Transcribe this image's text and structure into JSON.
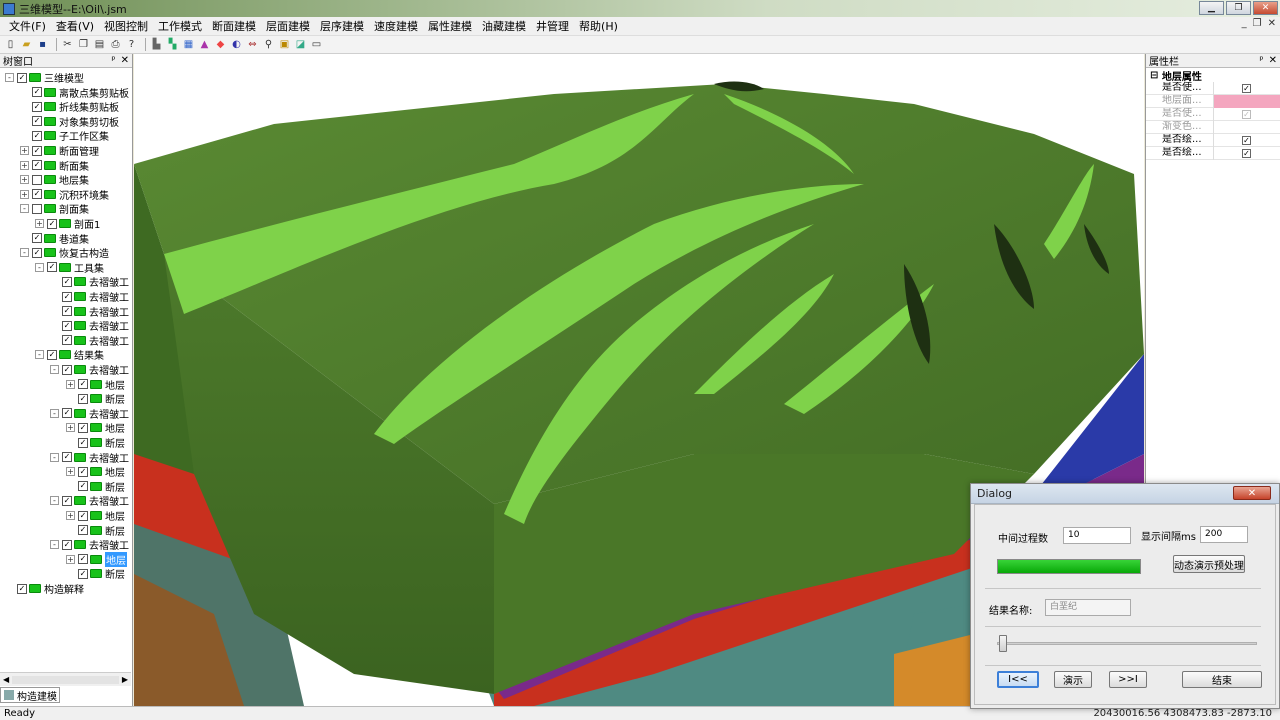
{
  "window": {
    "title": "三维模型--E:\\Oil\\.jsm"
  },
  "menu": [
    "文件(F)",
    "查看(V)",
    "视图控制",
    "工作模式",
    "断面建模",
    "层面建模",
    "层序建模",
    "速度建模",
    "属性建模",
    "油藏建模",
    "井管理",
    "帮助(H)"
  ],
  "toolbar_icons": [
    "new-icon",
    "open-icon",
    "save-icon",
    "cut-icon",
    "copy-icon",
    "paste-icon",
    "print-icon",
    "help-icon",
    "pan-icon",
    "fit-icon",
    "grid-icon",
    "layer-icon",
    "color-icon",
    "palette-icon",
    "arrows-icon",
    "zoom-icon",
    "rect-icon",
    "select-icon",
    "window-icon"
  ],
  "left_panel": {
    "title": "树窗口",
    "tab": "构造建模"
  },
  "tree": [
    {
      "label": "三维模型",
      "level": 0,
      "expand": "-",
      "checked": true
    },
    {
      "label": "离散点集剪贴板",
      "level": 1,
      "expand": "",
      "checked": true
    },
    {
      "label": "折线集剪贴板",
      "level": 1,
      "expand": "",
      "checked": true
    },
    {
      "label": "对象集剪切板",
      "level": 1,
      "expand": "",
      "checked": true
    },
    {
      "label": "子工作区集",
      "level": 1,
      "expand": "",
      "checked": true
    },
    {
      "label": "断面管理",
      "level": 1,
      "expand": "+",
      "checked": true
    },
    {
      "label": "断面集",
      "level": 1,
      "expand": "+",
      "checked": true
    },
    {
      "label": "地层集",
      "level": 1,
      "expand": "+",
      "checked": false
    },
    {
      "label": "沉积环境集",
      "level": 1,
      "expand": "+",
      "checked": true
    },
    {
      "label": "剖面集",
      "level": 1,
      "expand": "-",
      "checked": false
    },
    {
      "label": "剖面1",
      "level": 2,
      "expand": "+",
      "checked": true
    },
    {
      "label": "巷道集",
      "level": 1,
      "expand": "",
      "checked": true
    },
    {
      "label": "恢复古构造",
      "level": 1,
      "expand": "-",
      "checked": true
    },
    {
      "label": "工具集",
      "level": 2,
      "expand": "-",
      "checked": true
    },
    {
      "label": "去褶皱工",
      "level": 3,
      "expand": "",
      "checked": true
    },
    {
      "label": "去褶皱工",
      "level": 3,
      "expand": "",
      "checked": true
    },
    {
      "label": "去褶皱工",
      "level": 3,
      "expand": "",
      "checked": true
    },
    {
      "label": "去褶皱工",
      "level": 3,
      "expand": "",
      "checked": true
    },
    {
      "label": "去褶皱工",
      "level": 3,
      "expand": "",
      "checked": true
    },
    {
      "label": "结果集",
      "level": 2,
      "expand": "-",
      "checked": true
    },
    {
      "label": "去褶皱工",
      "level": 3,
      "expand": "-",
      "checked": true
    },
    {
      "label": "地层",
      "level": 4,
      "expand": "+",
      "checked": true
    },
    {
      "label": "断层",
      "level": 4,
      "expand": "",
      "checked": true
    },
    {
      "label": "去褶皱工",
      "level": 3,
      "expand": "-",
      "checked": true
    },
    {
      "label": "地层",
      "level": 4,
      "expand": "+",
      "checked": true
    },
    {
      "label": "断层",
      "level": 4,
      "expand": "",
      "checked": true
    },
    {
      "label": "去褶皱工",
      "level": 3,
      "expand": "-",
      "checked": true
    },
    {
      "label": "地层",
      "level": 4,
      "expand": "+",
      "checked": true
    },
    {
      "label": "断层",
      "level": 4,
      "expand": "",
      "checked": true
    },
    {
      "label": "去褶皱工",
      "level": 3,
      "expand": "-",
      "checked": true
    },
    {
      "label": "地层",
      "level": 4,
      "expand": "+",
      "checked": true
    },
    {
      "label": "断层",
      "level": 4,
      "expand": "",
      "checked": true
    },
    {
      "label": "去褶皱工",
      "level": 3,
      "expand": "-",
      "checked": true
    },
    {
      "label": "地层",
      "level": 4,
      "expand": "+",
      "checked": true,
      "selected": true
    },
    {
      "label": "断层",
      "level": 4,
      "expand": "",
      "checked": true
    },
    {
      "label": "构造解释",
      "level": 0,
      "expand": "",
      "checked": true
    }
  ],
  "right_panel": {
    "title": "属性栏",
    "group": "地层属性",
    "rows": [
      {
        "key": "是否使...",
        "value": "checked",
        "enabled": true
      },
      {
        "key": "地层面...",
        "value": "color",
        "color": "#f4a6bf",
        "enabled": false
      },
      {
        "key": "是否使...",
        "value": "checked",
        "enabled": false
      },
      {
        "key": "渐变色...",
        "value": "",
        "enabled": false
      },
      {
        "key": "是否绘...",
        "value": "checked",
        "enabled": true
      },
      {
        "key": "是否绘...",
        "value": "checked",
        "enabled": true
      }
    ]
  },
  "dialog": {
    "title": "Dialog",
    "mid_label": "中间过程数",
    "mid_value": "10",
    "interval_label": "显示间隔ms",
    "interval_value": "200",
    "preprocess_button": "动态演示预处理",
    "progress": 1.0,
    "result_label": "结果名称:",
    "result_value": "白垩纪",
    "slider": 0.0,
    "btn_first": "I<<",
    "btn_demo": "演示",
    "btn_last": ">>I",
    "btn_end": "结束"
  },
  "status": {
    "text": "Ready",
    "coords": "20430016.56  4308473.83  -2873.10"
  },
  "colors": {
    "terrain": "#4e7a2c",
    "terrain_light": "#7fd24a",
    "layer_blue": "#2a3aa8",
    "layer_purple": "#7a2a8a",
    "layer_red": "#c8301e",
    "layer_teal": "#4f8a82",
    "layer_orange": "#d48a2a"
  }
}
